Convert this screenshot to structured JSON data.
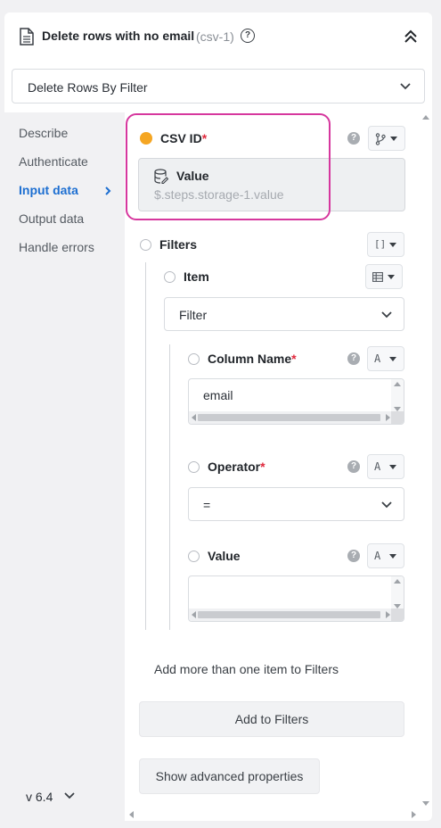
{
  "header": {
    "title": "Delete rows with no email",
    "step_id": "(csv-1)",
    "help_glyph": "?"
  },
  "action": {
    "selected": "Delete Rows By Filter"
  },
  "nav": {
    "items": [
      {
        "label": "Describe"
      },
      {
        "label": "Authenticate"
      },
      {
        "label": "Input data",
        "active": true
      },
      {
        "label": "Output data"
      },
      {
        "label": "Handle errors"
      }
    ],
    "version": "v 6.4"
  },
  "fields": {
    "csv_id": {
      "label": "CSV ID",
      "required_mark": "*",
      "value_title": "Value",
      "value_expr": "$.steps.storage-1.value"
    },
    "filters": {
      "label": "Filters",
      "type_glyph": "[]",
      "item_label": "Item",
      "item_type_glyph": "▦",
      "item_select": "Filter",
      "column_name": {
        "label": "Column Name",
        "required_mark": "*",
        "type_glyph": "A",
        "value": "email"
      },
      "operator": {
        "label": "Operator",
        "required_mark": "*",
        "type_glyph": "A",
        "value": "="
      },
      "value": {
        "label": "Value",
        "type_glyph": "A",
        "value": ""
      },
      "add_more_text": "Add more than one item to Filters",
      "add_button": "Add to Filters"
    },
    "advanced_button": "Show advanced properties"
  },
  "colors": {
    "accent": "#1d6fd1",
    "highlight": "#d6379e",
    "required": "#e0283c",
    "status_dot": "#f5a623"
  }
}
